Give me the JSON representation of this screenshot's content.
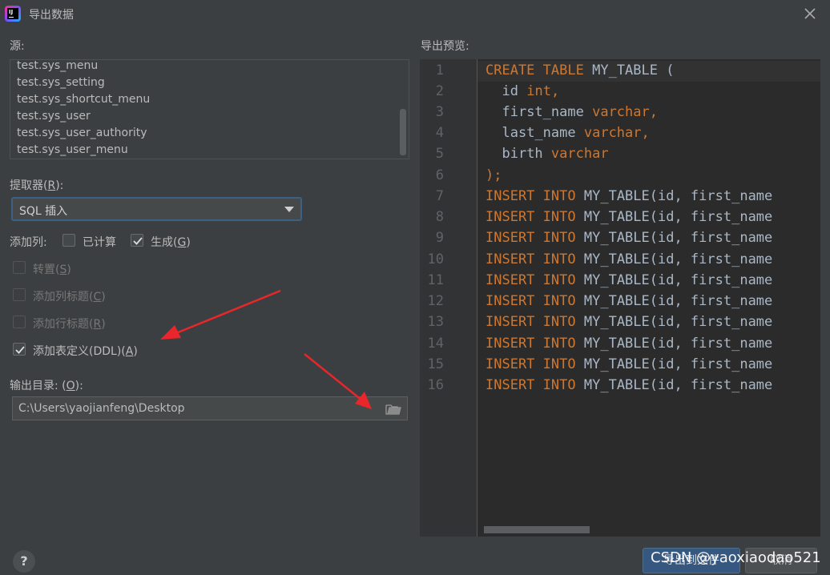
{
  "window": {
    "title": "导出数据"
  },
  "source": {
    "label": "源:",
    "items": [
      "test.sys_menu",
      "test.sys_setting",
      "test.sys_shortcut_menu",
      "test.sys_user",
      "test.sys_user_authority",
      "test.sys_user_menu"
    ]
  },
  "extractor": {
    "label": "提取器",
    "mnemonic": "R",
    "value": "SQL 插入"
  },
  "add_columns": {
    "label": "添加列:",
    "computed": {
      "label": "已计算",
      "checked": false
    },
    "generated": {
      "label": "生成",
      "mnemonic": "G",
      "checked": true
    }
  },
  "options": [
    {
      "label": "转置",
      "mnemonic": "S",
      "checked": false,
      "enabled": false
    },
    {
      "label": "添加列标题",
      "mnemonic": "C",
      "checked": false,
      "enabled": false
    },
    {
      "label": "添加行标题",
      "mnemonic": "R",
      "checked": false,
      "enabled": false
    },
    {
      "label": "添加表定义(DDL)",
      "mnemonic": "A",
      "checked": true,
      "enabled": true
    }
  ],
  "output": {
    "label": "输出目录: ",
    "mnemonic": "O",
    "path": "C:\\Users\\yaojianfeng\\Desktop"
  },
  "preview": {
    "label": "导出预览:",
    "line_numbers": [
      "1",
      "2",
      "3",
      "4",
      "5",
      "6",
      "7",
      "8",
      "9",
      "10",
      "11",
      "12",
      "13",
      "14",
      "15",
      "16"
    ],
    "create": {
      "kw1": "CREATE",
      "kw2": "TABLE",
      "name": "MY_TABLE",
      "paren": "("
    },
    "columns": [
      {
        "name": "id",
        "type": "int",
        "sep": ","
      },
      {
        "name": "first_name",
        "type": "varchar",
        "sep": ","
      },
      {
        "name": "last_name",
        "type": "varchar",
        "sep": ","
      },
      {
        "name": "birth",
        "type": "varchar",
        "sep": ""
      }
    ],
    "close": ");",
    "insert": {
      "kw1": "INSERT",
      "kw2": "INTO",
      "rest": "MY_TABLE(id, first_name"
    }
  },
  "buttons": {
    "help": "?",
    "export": "导出到文件",
    "cancel": "取消"
  },
  "watermark": "CSDN @yaoxiaodao521",
  "colors": {
    "background": "#3c3f41",
    "editor": "#2b2b2b",
    "keyword": "#cc7832",
    "identifier": "#a9b7c6",
    "arrow": "#e8262b",
    "primary_button": "#365880"
  }
}
